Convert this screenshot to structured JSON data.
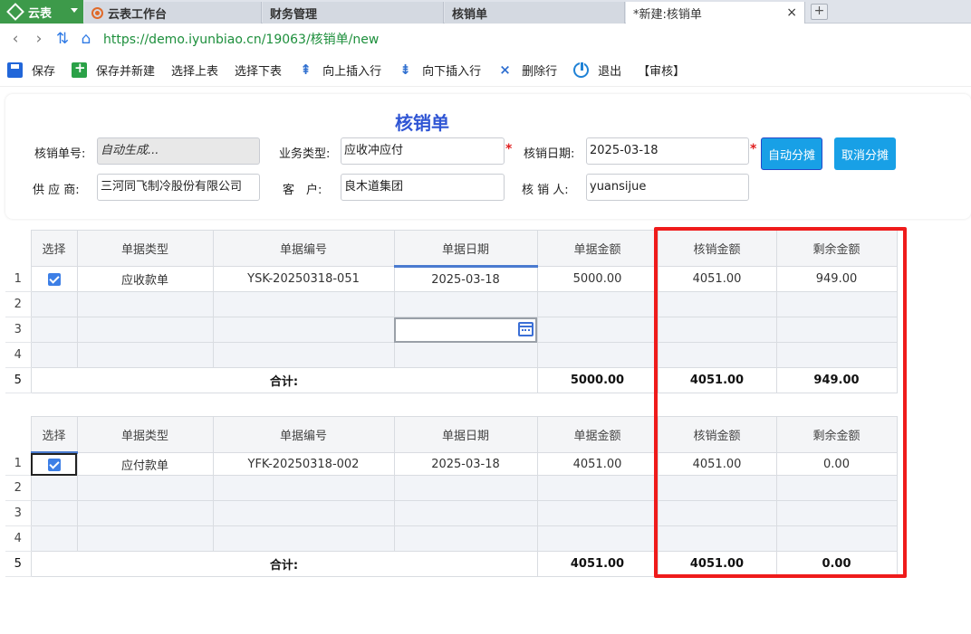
{
  "browser": {
    "logo_tab": "云表",
    "tabs": [
      "云表工作台",
      "财务管理",
      "核销单",
      "*新建:核销单"
    ],
    "active_tab_close": "×",
    "new_tab": "+",
    "url": "https://demo.iyunbiao.cn/19063/核销单/new"
  },
  "toolbar": {
    "items": [
      "保存",
      "保存并新建",
      "选择上表",
      "选择下表",
      "向上插入行",
      "向下插入行",
      "删除行",
      "退出",
      "【审核】"
    ]
  },
  "form": {
    "title": "核销单",
    "fields": {
      "doc_no_label": "核销单号:",
      "doc_no_value": "自动生成...",
      "biz_type_label": "业务类型:",
      "biz_type_value": "应收冲应付",
      "date_label": "核销日期:",
      "date_value": "2025-03-18",
      "supplier_label": "供 应 商:",
      "supplier_value": "三河同飞制冷股份有限公司",
      "customer_label": "客　户:",
      "customer_value": "良木道集团",
      "operator_label": "核 销 人:",
      "operator_value": "yuansijue"
    },
    "required_mark": "*",
    "buttons": {
      "auto_alloc": "自动分摊",
      "cancel_alloc": "取消分摊"
    }
  },
  "grid_top": {
    "headers": [
      "选择",
      "单据类型",
      "单据编号",
      "单据日期",
      "单据金额",
      "核销金额",
      "剩余金额"
    ],
    "row_numbers": [
      "1",
      "2",
      "3",
      "4",
      "5"
    ],
    "row1": {
      "type": "应收款单",
      "code": "YSK-20250318-051",
      "date": "2025-03-18",
      "amount": "5000.00",
      "writeoff": "4051.00",
      "remaining": "949.00"
    },
    "total": {
      "label": "合计:",
      "amount": "5000.00",
      "writeoff": "4051.00",
      "remaining": "949.00"
    }
  },
  "grid_bottom": {
    "headers": [
      "选择",
      "单据类型",
      "单据编号",
      "单据日期",
      "单据金额",
      "核销金额",
      "剩余金额"
    ],
    "row_numbers": [
      "1",
      "2",
      "3",
      "4",
      "5"
    ],
    "row1": {
      "type": "应付款单",
      "code": "YFK-20250318-002",
      "date": "2025-03-18",
      "amount": "4051.00",
      "writeoff": "4051.00",
      "remaining": "0.00"
    },
    "total": {
      "label": "合计:",
      "amount": "4051.00",
      "writeoff": "4051.00",
      "remaining": "0.00"
    }
  },
  "colors": {
    "accent": "#18a0e6",
    "title": "#2f55d4",
    "highlight": "#ef1b1b",
    "brand": "#3d9a4a"
  }
}
